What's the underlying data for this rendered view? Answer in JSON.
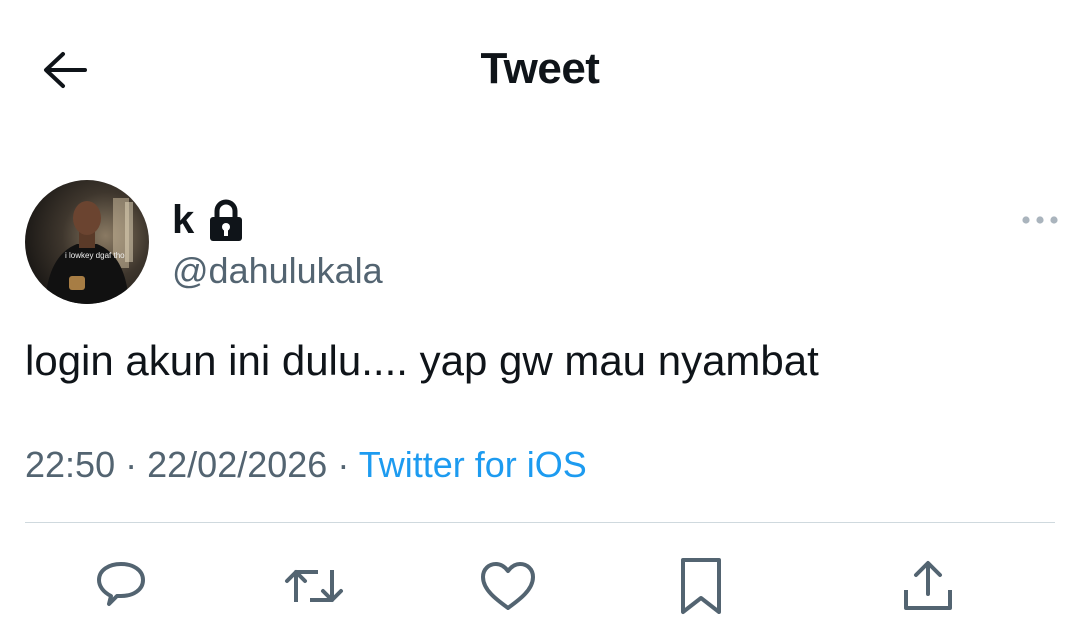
{
  "header": {
    "title": "Tweet"
  },
  "tweet": {
    "author": {
      "display_name": "k",
      "handle": "@dahulukala",
      "protected": true,
      "avatar_caption": "i lowkey dgaf tho"
    },
    "text": "login akun ini dulu.... yap gw mau nyambat",
    "time": "22:50",
    "separator": "·",
    "date": "22/02/2026",
    "source": "Twitter for iOS"
  },
  "actions": [
    {
      "name": "reply",
      "icon": "reply-icon"
    },
    {
      "name": "retweet",
      "icon": "retweet-icon"
    },
    {
      "name": "like",
      "icon": "like-icon"
    },
    {
      "name": "bookmark",
      "icon": "bookmark-icon"
    },
    {
      "name": "share",
      "icon": "share-icon"
    }
  ],
  "colors": {
    "text_primary": "#0f1419",
    "text_secondary": "#536471",
    "accent": "#1d9bf0",
    "divider": "#cfd9de"
  }
}
